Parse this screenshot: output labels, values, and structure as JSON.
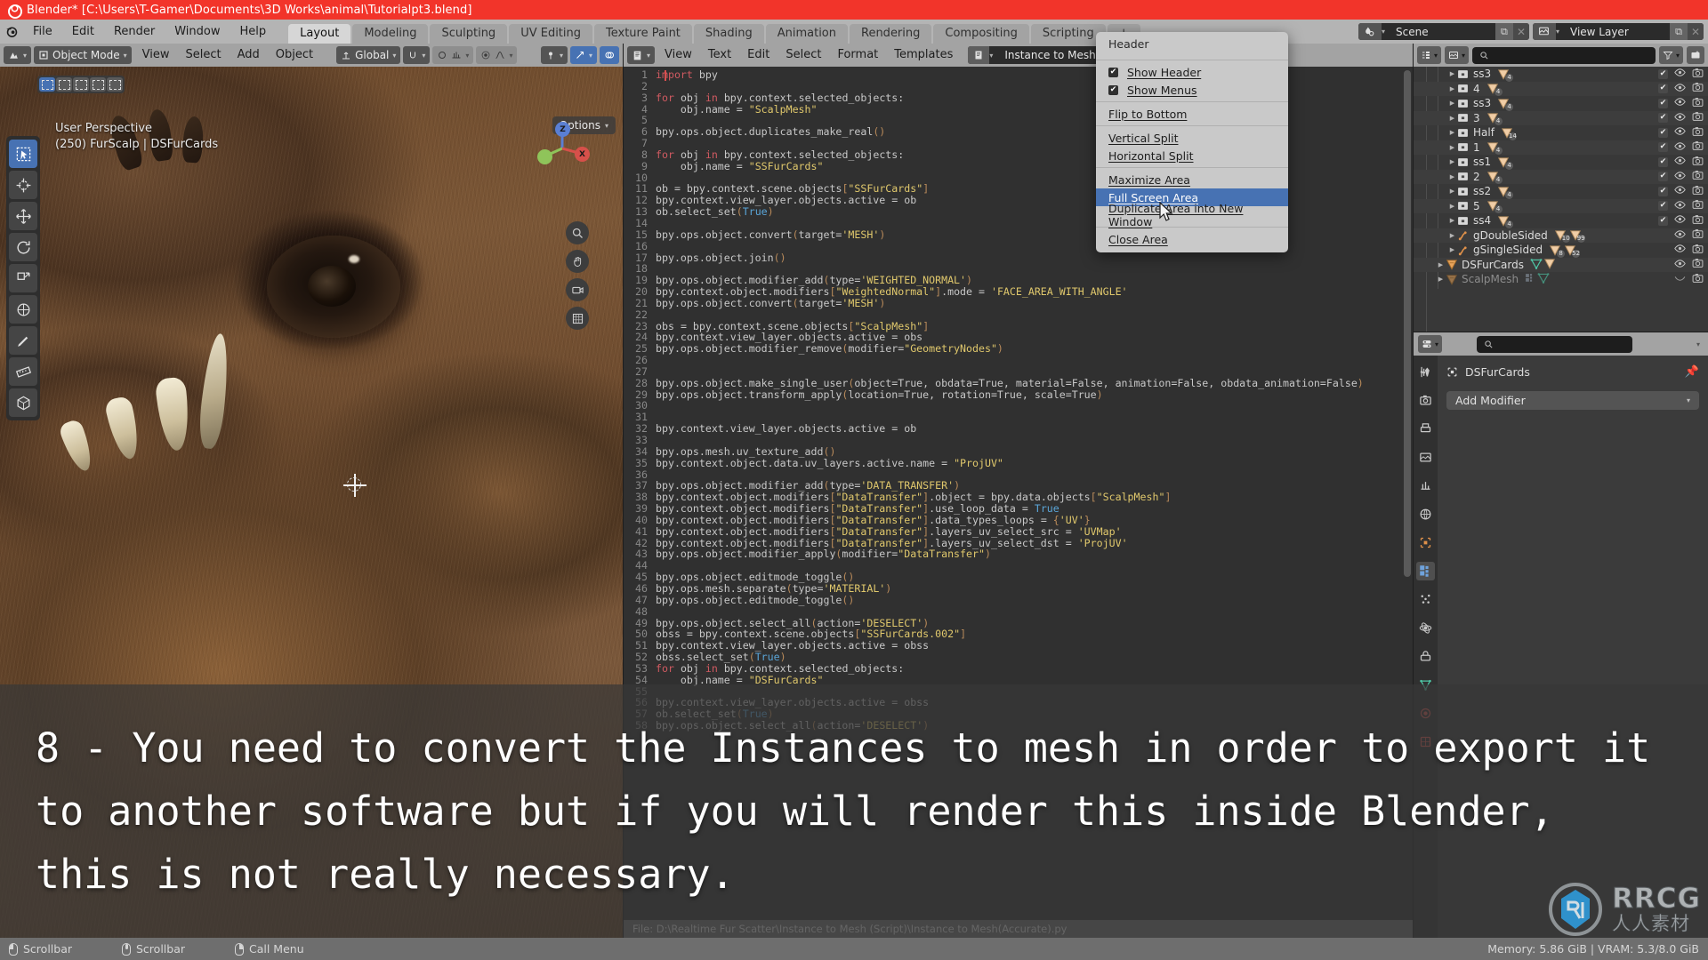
{
  "titlebar": {
    "title": "Blender* [C:\\Users\\T-Gamer\\Documents\\3D Works\\animal\\Tutorialpt3.blend]",
    "icon": "blender-logo-icon"
  },
  "topbar": {
    "menus": [
      "File",
      "Edit",
      "Render",
      "Window",
      "Help"
    ],
    "tabs": [
      "Layout",
      "Modeling",
      "Sculpting",
      "UV Editing",
      "Texture Paint",
      "Shading",
      "Animation",
      "Rendering",
      "Compositing",
      "Scripting",
      "+"
    ],
    "active_tab": "Layout",
    "scene": {
      "label": "Scene",
      "icon": "scene-icon"
    },
    "view_layer": {
      "label": "View Layer",
      "icon": "view-layer-icon"
    }
  },
  "viewport": {
    "mode": "Object Mode",
    "menus": [
      "View",
      "Select",
      "Add",
      "Object"
    ],
    "orientation": "Global",
    "overlay_text_line1": "User Perspective",
    "overlay_text_line2": "(250) FurScalp | DSFurCards",
    "options_label": "Options",
    "gizmo_axes": [
      {
        "label": "Z",
        "color": "#5a7fd4"
      },
      {
        "label": "Y",
        "color": "#8fc45a"
      },
      {
        "label": "X",
        "color": "#d6504a"
      }
    ],
    "tools": [
      "tweak-select-box-icon",
      "cursor-icon",
      "move-icon",
      "rotate-icon",
      "scale-icon",
      "transform-icon",
      "annotate-icon",
      "measure-icon",
      "add-cube-icon"
    ]
  },
  "editor": {
    "menus": [
      "View",
      "Text",
      "Edit",
      "Select",
      "Format",
      "Templates"
    ],
    "datablock_name": "Instance to Mesh(Accurate).py",
    "footer": "File: D:\\Realtime Fur Scatter\\Instance to Mesh (Script)\\Instance to Mesh(Accurate).py",
    "lines": [
      {
        "n": 1,
        "t": "import bpy"
      },
      {
        "n": 2,
        "t": ""
      },
      {
        "n": 3,
        "t": "for obj in bpy.context.selected_objects:"
      },
      {
        "n": 4,
        "t": "    obj.name = \"ScalpMesh\""
      },
      {
        "n": 5,
        "t": ""
      },
      {
        "n": 6,
        "t": "bpy.ops.object.duplicates_make_real()"
      },
      {
        "n": 7,
        "t": ""
      },
      {
        "n": 8,
        "t": "for obj in bpy.context.selected_objects:"
      },
      {
        "n": 9,
        "t": "    obj.name = \"SSFurCards\""
      },
      {
        "n": 10,
        "t": ""
      },
      {
        "n": 11,
        "t": "ob = bpy.context.scene.objects[\"SSFurCards\"]"
      },
      {
        "n": 12,
        "t": "bpy.context.view_layer.objects.active = ob"
      },
      {
        "n": 13,
        "t": "ob.select_set(True)"
      },
      {
        "n": 14,
        "t": ""
      },
      {
        "n": 15,
        "t": "bpy.ops.object.convert(target='MESH')"
      },
      {
        "n": 16,
        "t": ""
      },
      {
        "n": 17,
        "t": "bpy.ops.object.join()"
      },
      {
        "n": 18,
        "t": ""
      },
      {
        "n": 19,
        "t": "bpy.ops.object.modifier_add(type='WEIGHTED_NORMAL')"
      },
      {
        "n": 20,
        "t": "bpy.context.object.modifiers[\"WeightedNormal\"].mode = 'FACE_AREA_WITH_ANGLE'"
      },
      {
        "n": 21,
        "t": "bpy.ops.object.convert(target='MESH')"
      },
      {
        "n": 22,
        "t": ""
      },
      {
        "n": 23,
        "t": "obs = bpy.context.scene.objects[\"ScalpMesh\"]"
      },
      {
        "n": 24,
        "t": "bpy.context.view_layer.objects.active = obs"
      },
      {
        "n": 25,
        "t": "bpy.ops.object.modifier_remove(modifier=\"GeometryNodes\")"
      },
      {
        "n": 26,
        "t": ""
      },
      {
        "n": 27,
        "t": ""
      },
      {
        "n": 28,
        "t": "bpy.ops.object.make_single_user(object=True, obdata=True, material=False, animation=False, obdata_animation=False)"
      },
      {
        "n": 29,
        "t": "bpy.ops.object.transform_apply(location=True, rotation=True, scale=True)"
      },
      {
        "n": 30,
        "t": ""
      },
      {
        "n": 31,
        "t": ""
      },
      {
        "n": 32,
        "t": "bpy.context.view_layer.objects.active = ob"
      },
      {
        "n": 33,
        "t": ""
      },
      {
        "n": 34,
        "t": "bpy.ops.mesh.uv_texture_add()"
      },
      {
        "n": 35,
        "t": "bpy.context.object.data.uv_layers.active.name = \"ProjUV\""
      },
      {
        "n": 36,
        "t": ""
      },
      {
        "n": 37,
        "t": "bpy.ops.object.modifier_add(type='DATA_TRANSFER')"
      },
      {
        "n": 38,
        "t": "bpy.context.object.modifiers[\"DataTransfer\"].object = bpy.data.objects[\"ScalpMesh\"]"
      },
      {
        "n": 39,
        "t": "bpy.context.object.modifiers[\"DataTransfer\"].use_loop_data = True"
      },
      {
        "n": 40,
        "t": "bpy.context.object.modifiers[\"DataTransfer\"].data_types_loops = {'UV'}"
      },
      {
        "n": 41,
        "t": "bpy.context.object.modifiers[\"DataTransfer\"].layers_uv_select_src = 'UVMap'"
      },
      {
        "n": 42,
        "t": "bpy.context.object.modifiers[\"DataTransfer\"].layers_uv_select_dst = 'ProjUV'"
      },
      {
        "n": 43,
        "t": "bpy.ops.object.modifier_apply(modifier=\"DataTransfer\")"
      },
      {
        "n": 44,
        "t": ""
      },
      {
        "n": 45,
        "t": "bpy.ops.object.editmode_toggle()"
      },
      {
        "n": 46,
        "t": "bpy.ops.mesh.separate(type='MATERIAL')"
      },
      {
        "n": 47,
        "t": "bpy.ops.object.editmode_toggle()"
      },
      {
        "n": 48,
        "t": ""
      },
      {
        "n": 49,
        "t": "bpy.ops.object.select_all(action='DESELECT')"
      },
      {
        "n": 50,
        "t": "obss = bpy.context.scene.objects[\"SSFurCards.002\"]"
      },
      {
        "n": 51,
        "t": "bpy.context.view_layer.objects.active = obss"
      },
      {
        "n": 52,
        "t": "obss.select_set(True)"
      },
      {
        "n": 53,
        "t": "for obj in bpy.context.selected_objects:"
      },
      {
        "n": 54,
        "t": "    obj.name = \"DSFurCards\""
      },
      {
        "n": 55,
        "t": ""
      },
      {
        "n": 56,
        "t": "bpy.context.view_layer.objects.active = obss"
      },
      {
        "n": 57,
        "t": "ob.select_set(True)"
      },
      {
        "n": 58,
        "t": "bpy.ops.object.select_all(action='DESELECT')"
      }
    ]
  },
  "outliner": {
    "rows": [
      {
        "indent": 3,
        "icon": "collection-icon",
        "label": "ss3",
        "counts": [
          "4"
        ],
        "checkbox": true,
        "eye": true,
        "camera": true,
        "dim": false
      },
      {
        "indent": 3,
        "icon": "collection-icon",
        "label": "4",
        "counts": [
          "4"
        ],
        "checkbox": true,
        "eye": true,
        "camera": true,
        "dim": false
      },
      {
        "indent": 3,
        "icon": "collection-icon",
        "label": "ss3",
        "counts": [
          "4"
        ],
        "checkbox": true,
        "eye": true,
        "camera": true,
        "dim": false
      },
      {
        "indent": 3,
        "icon": "collection-icon",
        "label": "3",
        "counts": [
          "4"
        ],
        "checkbox": true,
        "eye": true,
        "camera": true,
        "dim": false
      },
      {
        "indent": 3,
        "icon": "collection-icon",
        "label": "Half",
        "counts": [
          "14"
        ],
        "checkbox": true,
        "eye": true,
        "camera": true,
        "dim": false
      },
      {
        "indent": 3,
        "icon": "collection-icon",
        "label": "1",
        "counts": [
          "4"
        ],
        "checkbox": true,
        "eye": true,
        "camera": true,
        "dim": false
      },
      {
        "indent": 3,
        "icon": "collection-icon",
        "label": "ss1",
        "counts": [
          "4"
        ],
        "checkbox": true,
        "eye": true,
        "camera": true,
        "dim": false
      },
      {
        "indent": 3,
        "icon": "collection-icon",
        "label": "2",
        "counts": [
          "4"
        ],
        "checkbox": true,
        "eye": true,
        "camera": true,
        "dim": false
      },
      {
        "indent": 3,
        "icon": "collection-icon",
        "label": "ss2",
        "counts": [
          "4"
        ],
        "checkbox": true,
        "eye": true,
        "camera": true,
        "dim": false
      },
      {
        "indent": 3,
        "icon": "collection-icon",
        "label": "5",
        "counts": [
          "4"
        ],
        "checkbox": true,
        "eye": true,
        "camera": true,
        "dim": false
      },
      {
        "indent": 3,
        "icon": "collection-icon",
        "label": "ss4",
        "counts": [
          "4"
        ],
        "checkbox": true,
        "eye": true,
        "camera": true,
        "dim": false
      },
      {
        "indent": 3,
        "icon": "armature-icon",
        "label": "gDoubleSided",
        "counts": [
          "10",
          "99"
        ],
        "checkbox": false,
        "eye": true,
        "camera": true,
        "dim": false
      },
      {
        "indent": 3,
        "icon": "armature-icon",
        "label": "gSingleSided",
        "counts": [
          "8",
          "52"
        ],
        "checkbox": false,
        "eye": true,
        "camera": true,
        "dim": false
      },
      {
        "indent": 2,
        "icon": "mesh-object-icon",
        "label": "DSFurCards",
        "counts": [
          "mesh-data-icon",
          "mesh-tri-icon"
        ],
        "checkbox": false,
        "eye": true,
        "camera": true,
        "dim": false
      },
      {
        "indent": 2,
        "icon": "mesh-object-icon",
        "label": "ScalpMesh",
        "counts": [
          "modifier-icon",
          "mesh-data-icon"
        ],
        "checkbox": false,
        "eye": false,
        "camera": true,
        "dim": true
      }
    ]
  },
  "properties": {
    "object_name": "DSFurCards",
    "add_modifier_label": "Add Modifier",
    "tabs": [
      "tool-icon",
      "render-icon",
      "output-icon",
      "view-layer-icon",
      "scene-icon",
      "world-icon",
      "object-icon",
      "modifier-icon",
      "particles-icon",
      "physics-icon",
      "constraints-icon",
      "data-icon",
      "material-icon",
      "texture-icon"
    ],
    "active_tab_index": 7
  },
  "context_menu": {
    "title": "Header",
    "items": [
      {
        "label": "Show Header",
        "checkbox": true,
        "checked": true,
        "highlight": false,
        "sep_after": false
      },
      {
        "label": "Show Menus",
        "checkbox": true,
        "checked": true,
        "highlight": false,
        "sep_after": true
      },
      {
        "label": "Flip to Bottom",
        "checkbox": false,
        "checked": false,
        "highlight": false,
        "sep_after": true
      },
      {
        "label": "Vertical Split",
        "checkbox": false,
        "checked": false,
        "highlight": false,
        "sep_after": false
      },
      {
        "label": "Horizontal Split",
        "checkbox": false,
        "checked": false,
        "highlight": false,
        "sep_after": true
      },
      {
        "label": "Maximize Area",
        "checkbox": false,
        "checked": false,
        "highlight": false,
        "sep_after": false
      },
      {
        "label": "Full Screen Area",
        "checkbox": false,
        "checked": false,
        "highlight": true,
        "sep_after": false
      },
      {
        "label": "Duplicate Area into New Window",
        "checkbox": false,
        "checked": false,
        "highlight": false,
        "sep_after": true
      },
      {
        "label": "Close Area",
        "checkbox": false,
        "checked": false,
        "highlight": false,
        "sep_after": false
      }
    ]
  },
  "subtitle": {
    "text": "8 - You need to convert the Instances to mesh in order to export it to another software but if you will render this inside Blender, this is not really necessary."
  },
  "watermark": {
    "brand": "RRCG",
    "sub": "人人素材"
  },
  "statusbar": {
    "items": [
      {
        "mouse": "left",
        "label": "Scrollbar"
      },
      {
        "mouse": "mid",
        "label": "Scrollbar"
      },
      {
        "mouse": "right",
        "label": "Call Menu"
      }
    ],
    "memory": "Memory: 5.86 GiB | VRAM: 5.3/8.0 GiB"
  },
  "colors": {
    "title_bar": "#f2342a",
    "header_gray": "#a3a3a3",
    "accent_blue": "#4772b3",
    "editor_bg": "#303030",
    "panel_bg": "#383838"
  }
}
